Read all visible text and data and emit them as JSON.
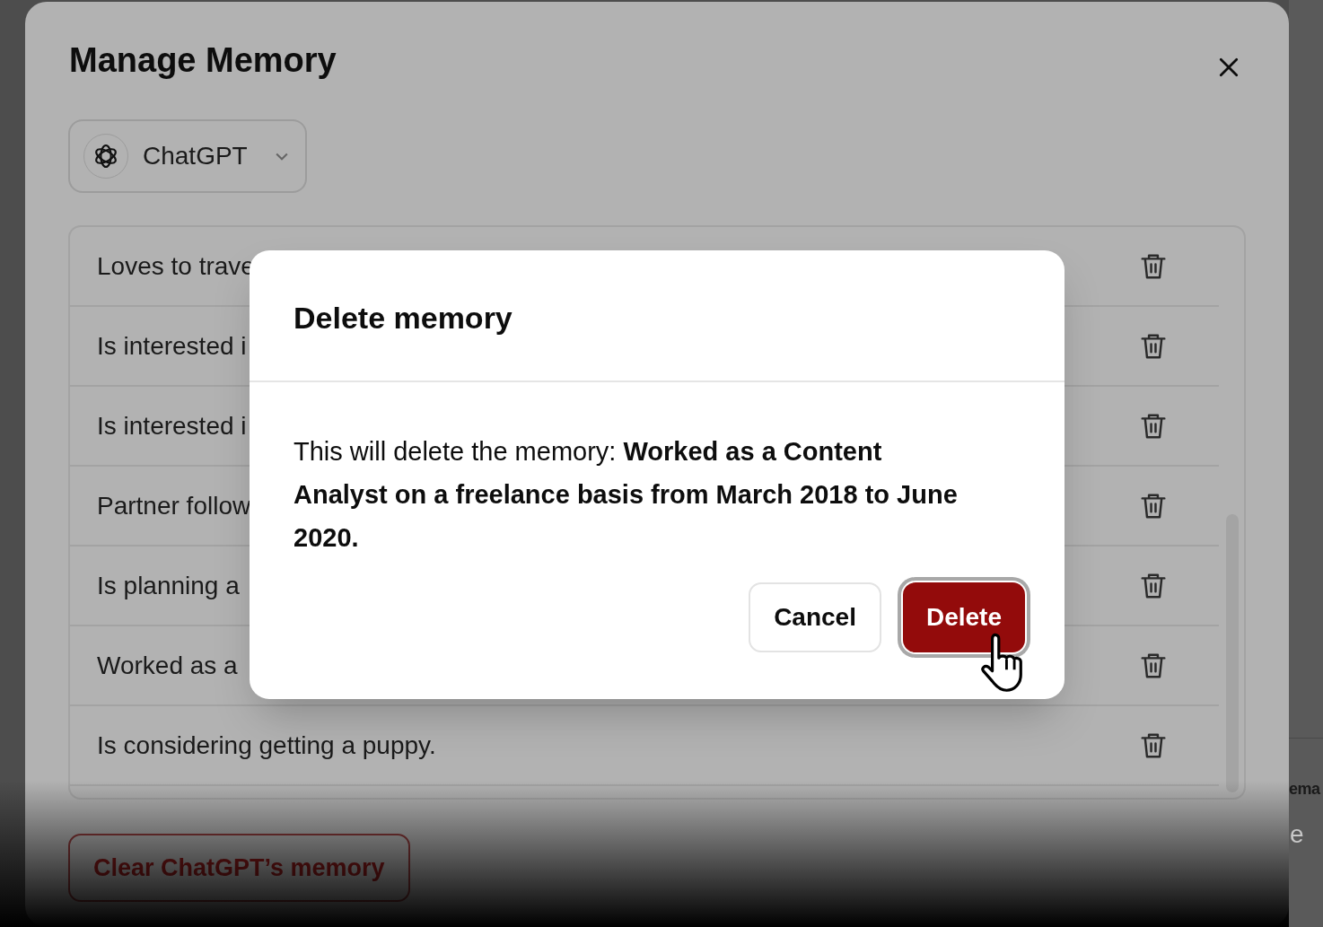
{
  "dialog": {
    "title": "Manage Memory",
    "model_selector": {
      "value": "ChatGPT"
    },
    "memories": [
      {
        "text": "Loves to trave"
      },
      {
        "text": "Is interested i"
      },
      {
        "text": "Is interested i"
      },
      {
        "text": "Partner follow"
      },
      {
        "text": "Is planning a"
      },
      {
        "text": "Worked as a"
      },
      {
        "text": "Is considering getting a puppy."
      }
    ],
    "clear_button": "Clear ChatGPT’s memory"
  },
  "background_panel": {
    "texts": [
      "ema",
      "e"
    ]
  },
  "confirm_modal": {
    "title": "Delete memory",
    "message": "This will delete the memory: **Worked as a Content Analyst on a freelance basis from March 2018 to June 2020.**",
    "buttons": [
      {
        "label": "Cancel",
        "kind": "secondary"
      },
      {
        "label": "Delete",
        "kind": "danger"
      }
    ]
  }
}
